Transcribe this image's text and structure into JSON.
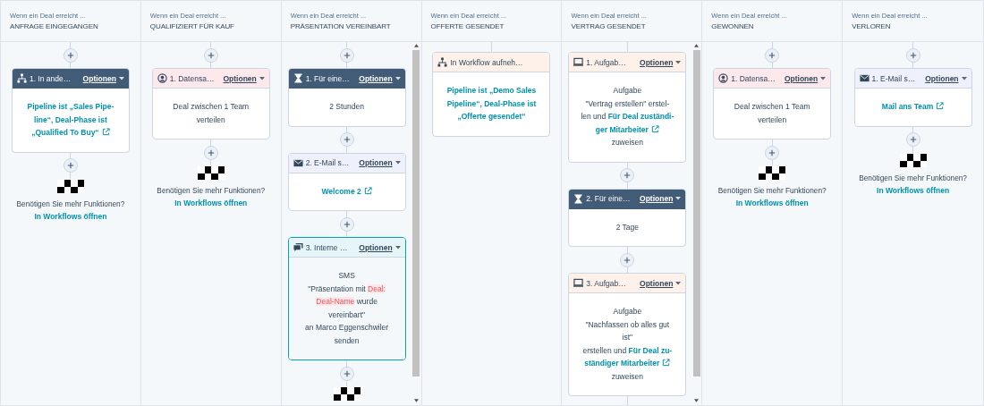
{
  "columns": [
    {
      "trigger": "Wenn ein Deal erreicht ...",
      "stage": "ANFRAGE EINGEGANGEN",
      "scrollable": false,
      "steps": [
        {
          "kind": "add"
        },
        {
          "kind": "branch",
          "selected": false,
          "title": "1. In ande…",
          "options": "Optionen",
          "lines": [
            [
              {
                "kind": "link",
                "text": "Pipeline ist „Sales Pipe-"
              }
            ],
            [
              {
                "kind": "link",
                "text": "line“, Deal-Phase ist"
              }
            ],
            [
              {
                "kind": "link",
                "text": "„Qualified To Buy“",
                "external": true
              }
            ]
          ]
        },
        {
          "kind": "add"
        },
        {
          "kind": "end",
          "hint": "Benötigen Sie mehr Funktionen?",
          "link": "In Workflows öffnen"
        }
      ]
    },
    {
      "trigger": "Wenn ein Deal erreicht ...",
      "stage": "QUALIFIZIERT FÜR KAUF",
      "scrollable": false,
      "steps": [
        {
          "kind": "add"
        },
        {
          "kind": "rotate",
          "selected": false,
          "title": "1. Datensa…",
          "options": "Optionen",
          "lines": [
            [
              {
                "kind": "text",
                "text": "Deal zwischen 1 Team"
              }
            ],
            [
              {
                "kind": "text",
                "text": "verteilen"
              }
            ]
          ]
        },
        {
          "kind": "add"
        },
        {
          "kind": "end",
          "hint": "Benötigen Sie mehr Funktionen?",
          "link": "In Workflows öffnen"
        }
      ]
    },
    {
      "trigger": "Wenn ein Deal erreicht ...",
      "stage": "PRÄSENTATION VEREINBART",
      "scrollable": true,
      "steps": [
        {
          "kind": "add"
        },
        {
          "kind": "delay",
          "selected": false,
          "title": "1. Für eine…",
          "options": "Optionen",
          "lines": [
            [
              {
                "kind": "text",
                "text": "2 Stunden"
              }
            ]
          ]
        },
        {
          "kind": "add"
        },
        {
          "kind": "email",
          "selected": false,
          "title": "2. E-Mail s…",
          "options": "Optionen",
          "lines": [
            [
              {
                "kind": "link",
                "text": "Welcome 2",
                "external": true
              }
            ]
          ]
        },
        {
          "kind": "add"
        },
        {
          "kind": "notification",
          "selected": true,
          "title": "3. Interne …",
          "options": "Optionen",
          "lines": [
            [
              {
                "kind": "text",
                "text": "SMS"
              }
            ],
            [
              {
                "kind": "text",
                "text": "\"Präsentation mit "
              },
              {
                "kind": "token",
                "text": "Deal:"
              }
            ],
            [
              {
                "kind": "token",
                "text": "Deal-Name"
              },
              {
                "kind": "text",
                "text": " wurde"
              }
            ],
            [
              {
                "kind": "text",
                "text": "vereinbart\""
              }
            ],
            [
              {
                "kind": "text",
                "text": "an Marco Eggenschwiler"
              }
            ],
            [
              {
                "kind": "text",
                "text": "senden"
              }
            ]
          ]
        },
        {
          "kind": "add"
        },
        {
          "kind": "end"
        }
      ]
    },
    {
      "trigger": "Wenn ein Deal erreicht ...",
      "stage": "OFFERTE GESENDET",
      "scrollable": false,
      "steps": [
        {
          "kind": "connector"
        },
        {
          "kind": "enroll",
          "selected": false,
          "title": "In Workflow aufneh…",
          "lines": [
            [
              {
                "kind": "link",
                "text": "Pipeline ist „Demo Sales"
              }
            ],
            [
              {
                "kind": "link",
                "text": "Pipeline“, Deal-Phase ist"
              }
            ],
            [
              {
                "kind": "link",
                "text": "„Offerte gesendet“"
              }
            ]
          ]
        }
      ]
    },
    {
      "trigger": "Wenn ein Deal erreicht ...",
      "stage": "VERTRAG GESENDET",
      "scrollable": true,
      "steps": [
        {
          "kind": "connector"
        },
        {
          "kind": "task",
          "selected": false,
          "title": "1. Aufgab…",
          "options": "Optionen",
          "lines": [
            [
              {
                "kind": "text",
                "text": "Aufgabe"
              }
            ],
            [
              {
                "kind": "text",
                "text": "\"Vertrag erstellen\" erstel-"
              }
            ],
            [
              {
                "kind": "text",
                "text": "len und "
              },
              {
                "kind": "link",
                "text": "Für Deal zuständi-"
              }
            ],
            [
              {
                "kind": "link",
                "text": "ger Mitarbeiter",
                "external": true
              }
            ],
            [
              {
                "kind": "text",
                "text": "zuweisen"
              }
            ]
          ]
        },
        {
          "kind": "add"
        },
        {
          "kind": "delay",
          "selected": false,
          "title": "2. Für eine…",
          "options": "Optionen",
          "lines": [
            [
              {
                "kind": "text",
                "text": "2 Tage"
              }
            ]
          ]
        },
        {
          "kind": "add"
        },
        {
          "kind": "task",
          "selected": false,
          "title": "3. Aufgab…",
          "options": "Optionen",
          "lines": [
            [
              {
                "kind": "text",
                "text": "Aufgabe"
              }
            ],
            [
              {
                "kind": "text",
                "text": "\"Nachfassen ob alles gut"
              }
            ],
            [
              {
                "kind": "text",
                "text": "ist\""
              }
            ],
            [
              {
                "kind": "text",
                "text": "erstellen und "
              },
              {
                "kind": "link",
                "text": "Für Deal zu-"
              }
            ],
            [
              {
                "kind": "link",
                "text": "ständiger Mitarbeiter",
                "external": true
              }
            ],
            [
              {
                "kind": "text",
                "text": "zuweisen"
              }
            ]
          ]
        },
        {
          "kind": "connector"
        }
      ]
    },
    {
      "trigger": "Wenn ein Deal erreicht ...",
      "stage": "GEWONNEN",
      "scrollable": false,
      "steps": [
        {
          "kind": "add"
        },
        {
          "kind": "rotate",
          "selected": false,
          "title": "1. Datensa…",
          "options": "Optionen",
          "lines": [
            [
              {
                "kind": "text",
                "text": "Deal zwischen 1 Team"
              }
            ],
            [
              {
                "kind": "text",
                "text": "verteilen"
              }
            ]
          ]
        },
        {
          "kind": "add"
        },
        {
          "kind": "end",
          "hint": "Benötigen Sie mehr Funktionen?",
          "link": "In Workflows öffnen"
        }
      ]
    },
    {
      "trigger": "Wenn ein Deal erreicht ...",
      "stage": "VERLOREN",
      "scrollable": false,
      "steps": [
        {
          "kind": "add"
        },
        {
          "kind": "email",
          "selected": false,
          "title": "1. E-Mail s…",
          "options": "Optionen",
          "lines": [
            [
              {
                "kind": "link",
                "text": "Mail ans Team",
                "external": true
              }
            ]
          ]
        },
        {
          "kind": "add"
        },
        {
          "kind": "end",
          "hint": "Benötigen Sie mehr Funktionen?",
          "link": "In Workflows öffnen"
        }
      ]
    }
  ]
}
